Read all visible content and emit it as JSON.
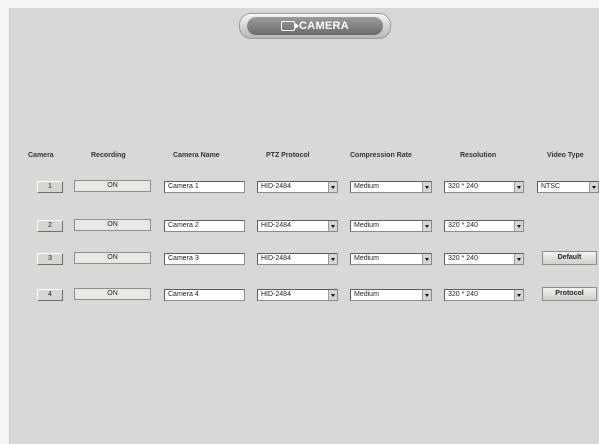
{
  "header": {
    "title": "CAMERA",
    "icon": "camera-icon"
  },
  "columns": [
    "Camera",
    "Recording",
    "Camera Name",
    "PTZ Protocol",
    "Compression Rate",
    "Resolution",
    "Video Type"
  ],
  "rows": [
    {
      "camera": "1",
      "recording": "ON",
      "name": "Camera 1",
      "ptz": "HID-2484",
      "compression": "Medium",
      "resolution": "320 * 240"
    },
    {
      "camera": "2",
      "recording": "ON",
      "name": "Camera 2",
      "ptz": "HID-2484",
      "compression": "Medium",
      "resolution": "320 * 240"
    },
    {
      "camera": "3",
      "recording": "ON",
      "name": "Camera 3",
      "ptz": "HID-2484",
      "compression": "Medium",
      "resolution": "320 * 240"
    },
    {
      "camera": "4",
      "recording": "ON",
      "name": "Camera 4",
      "ptz": "HID-2484",
      "compression": "Medium",
      "resolution": "320 * 240"
    }
  ],
  "video_type": "NTSC",
  "buttons": {
    "default": "Default",
    "protocol": "Protocol"
  }
}
